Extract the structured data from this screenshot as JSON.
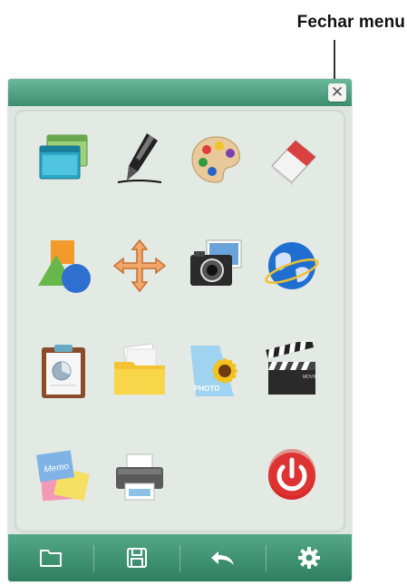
{
  "callout": {
    "label": "Fechar menu"
  },
  "panel": {
    "close_glyph": "✕",
    "icons": [
      {
        "name": "windows-icon"
      },
      {
        "name": "pen-icon"
      },
      {
        "name": "palette-icon"
      },
      {
        "name": "eraser-icon"
      },
      {
        "name": "shapes-icon"
      },
      {
        "name": "move-icon"
      },
      {
        "name": "camera-icon"
      },
      {
        "name": "globe-icon"
      },
      {
        "name": "clipboard-icon"
      },
      {
        "name": "folder-icon"
      },
      {
        "name": "photo-icon"
      },
      {
        "name": "clapperboard-icon"
      },
      {
        "name": "memo-icon"
      },
      {
        "name": "printer-icon"
      },
      {
        "name": "power-icon"
      }
    ],
    "memo_text": "Memo",
    "photo_text": "PHOTO",
    "movie_text": "MOVIE"
  },
  "toolbar": {
    "buttons": [
      "open-folder-icon",
      "save-icon",
      "undo-icon",
      "settings-gear-icon"
    ]
  },
  "colors": {
    "theme_green": "#3c8f6f",
    "panel_bg": "#e3e9e3",
    "power_red": "#d62a2a"
  }
}
